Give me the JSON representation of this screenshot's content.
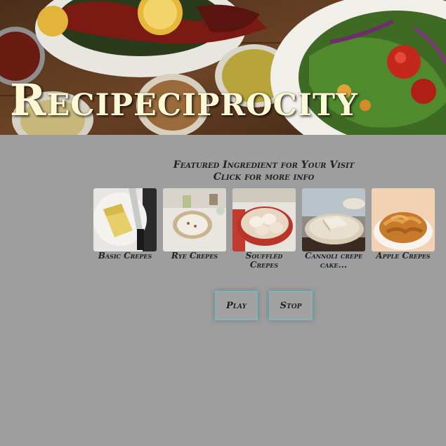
{
  "banner": {
    "title": "Recipeciprocity"
  },
  "featured": {
    "heading_line1": "Featured Ingredient for Your Visit",
    "heading_line2": "Click for more info",
    "items": [
      {
        "label": "Basic Crepes"
      },
      {
        "label": "Rye Crepes"
      },
      {
        "label": "Souffléd Crepes"
      },
      {
        "label": "Cannoli crepe cake..."
      },
      {
        "label": "Apple Crepes"
      }
    ]
  },
  "controls": {
    "play_label": "Play",
    "stop_label": "Stop"
  },
  "colors": {
    "background": "#9e9e9e",
    "title": "#fff8d6",
    "button_border": "#57c7d4"
  }
}
